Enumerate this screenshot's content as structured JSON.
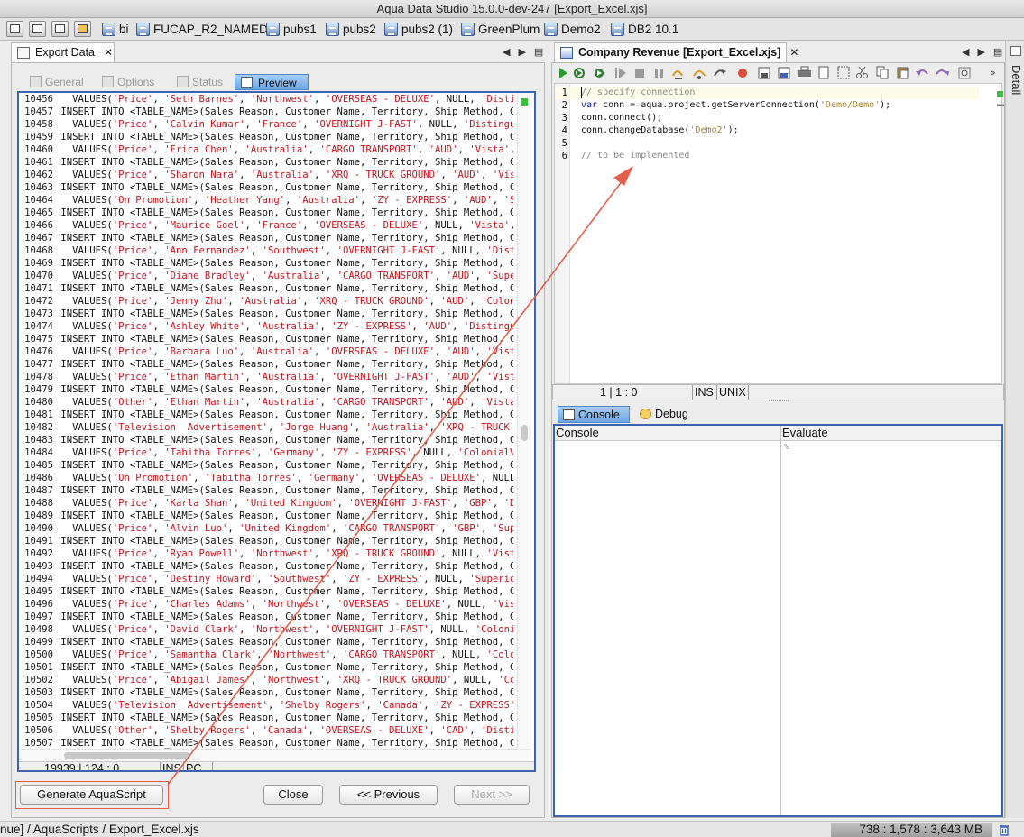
{
  "window": {
    "title": "Aqua Data Studio 15.0.0-dev-247 [Export_Excel.xjs]"
  },
  "connections": [
    {
      "name": "bi"
    },
    {
      "name": "FUCAP_R2_NAMED"
    },
    {
      "name": "pubs1"
    },
    {
      "name": "pubs2"
    },
    {
      "name": "pubs2 (1)"
    },
    {
      "name": "GreenPlum"
    },
    {
      "name": "Demo2"
    },
    {
      "name": "DB2 10.1"
    }
  ],
  "export_panel": {
    "tab_label": "Export Data",
    "close_glyph": "✕",
    "subtabs": {
      "general": "General",
      "options": "Options",
      "status": "Status",
      "preview": "Preview"
    },
    "sql_lines": [
      {
        "n": "10456",
        "k": "v",
        "vals": [
          "'Price'",
          "'Seth Barnes'",
          "'Northwest'",
          "'OVERSEAS - DELUXE'",
          "NULL",
          "'Distingui"
        ]
      },
      {
        "n": "10457",
        "k": "i"
      },
      {
        "n": "10458",
        "k": "v",
        "vals": [
          "'Price'",
          "'Calvin Kumar'",
          "'France'",
          "'OVERNIGHT J-FAST'",
          "NULL",
          "'Distinguish"
        ]
      },
      {
        "n": "10459",
        "k": "i"
      },
      {
        "n": "10460",
        "k": "v",
        "vals": [
          "'Price'",
          "'Erica Chen'",
          "'Australia'",
          "'CARGO TRANSPORT'",
          "'AUD'",
          "'Vista'",
          "'Sc"
        ]
      },
      {
        "n": "10461",
        "k": "i"
      },
      {
        "n": "10462",
        "k": "v",
        "vals": [
          "'Price'",
          "'Sharon Nara'",
          "'Australia'",
          "'XRQ - TRUCK GROUND'",
          "'AUD'",
          "'Vista'"
        ]
      },
      {
        "n": "10463",
        "k": "i"
      },
      {
        "n": "10464",
        "k": "v",
        "vals": [
          "'On Promotion'",
          "'Heather Yang'",
          "'Australia'",
          "'ZY - EXPRESS'",
          "'AUD'",
          "'Super"
        ]
      },
      {
        "n": "10465",
        "k": "i"
      },
      {
        "n": "10466",
        "k": "v",
        "vals": [
          "'Price'",
          "'Maurice Goel'",
          "'France'",
          "'OVERSEAS - DELUXE'",
          "NULL",
          "'Vista'",
          "'Po"
        ]
      },
      {
        "n": "10467",
        "k": "i"
      },
      {
        "n": "10468",
        "k": "v",
        "vals": [
          "'Price'",
          "'Ann Fernandez'",
          "'Southwest'",
          "'OVERNIGHT J-FAST'",
          "NULL",
          "'Distingu"
        ]
      },
      {
        "n": "10469",
        "k": "i"
      },
      {
        "n": "10470",
        "k": "v",
        "vals": [
          "'Price'",
          "'Diane Bradley'",
          "'Australia'",
          "'CARGO TRANSPORT'",
          "'AUD'",
          "'Superior"
        ]
      },
      {
        "n": "10471",
        "k": "i"
      },
      {
        "n": "10472",
        "k": "v",
        "vals": [
          "'Price'",
          "'Jenny Zhu'",
          "'Australia'",
          "'XRQ - TRUCK GROUND'",
          "'AUD'",
          "'ColonialV"
        ]
      },
      {
        "n": "10473",
        "k": "i"
      },
      {
        "n": "10474",
        "k": "v",
        "vals": [
          "'Price'",
          "'Ashley White'",
          "'Australia'",
          "'ZY - EXPRESS'",
          "'AUD'",
          "'Distinguish"
        ]
      },
      {
        "n": "10475",
        "k": "i"
      },
      {
        "n": "10476",
        "k": "v",
        "vals": [
          "'Price'",
          "'Barbara Luo'",
          "'Australia'",
          "'OVERSEAS - DELUXE'",
          "'AUD'",
          "'Vista'"
        ]
      },
      {
        "n": "10477",
        "k": "i"
      },
      {
        "n": "10478",
        "k": "v",
        "vals": [
          "'Price'",
          "'Ethan Martin'",
          "'Australia'",
          "'OVERNIGHT J-FAST'",
          "'AUD'",
          "'Vista'"
        ]
      },
      {
        "n": "10479",
        "k": "i"
      },
      {
        "n": "10480",
        "k": "v",
        "vals": [
          "'Other'",
          "'Ethan Martin'",
          "'Australia'",
          "'CARGO TRANSPORT'",
          "'AUD'",
          "'Vista'",
          "'"
        ]
      },
      {
        "n": "10481",
        "k": "i"
      },
      {
        "n": "10482",
        "k": "v",
        "vals": [
          "'Television  Advertisement'",
          "'Jorge Huang'",
          "'Australia'",
          "'XRQ - TRUCK GROU"
        ]
      },
      {
        "n": "10483",
        "k": "i"
      },
      {
        "n": "10484",
        "k": "v",
        "vals": [
          "'Price'",
          "'Tabitha Torres'",
          "'Germany'",
          "'ZY - EXPRESS'",
          "NULL",
          "'ColonialVoice"
        ]
      },
      {
        "n": "10485",
        "k": "i"
      },
      {
        "n": "10486",
        "k": "v",
        "vals": [
          "'On Promotion'",
          "'Tabitha Torres'",
          "'Germany'",
          "'OVERSEAS - DELUXE'",
          "NULL",
          "'C"
        ]
      },
      {
        "n": "10487",
        "k": "i"
      },
      {
        "n": "10488",
        "k": "v",
        "vals": [
          "'Price'",
          "'Karla Shan'",
          "'United Kingdom'",
          "'OVERNIGHT J-FAST'",
          "'GBP'",
          "'Disti"
        ]
      },
      {
        "n": "10489",
        "k": "i"
      },
      {
        "n": "10490",
        "k": "v",
        "vals": [
          "'Price'",
          "'Alvin Luo'",
          "'United Kingdom'",
          "'CARGO TRANSPORT'",
          "'GBP'",
          "'Superio"
        ]
      },
      {
        "n": "10491",
        "k": "i"
      },
      {
        "n": "10492",
        "k": "v",
        "vals": [
          "'Price'",
          "'Ryan Powell'",
          "'Northwest'",
          "'XRQ - TRUCK GROUND'",
          "NULL",
          "'Vista'"
        ]
      },
      {
        "n": "10493",
        "k": "i"
      },
      {
        "n": "10494",
        "k": "v",
        "vals": [
          "'Price'",
          "'Destiny Howard'",
          "'Southwest'",
          "'ZY - EXPRESS'",
          "NULL",
          "'SuperiorCar"
        ]
      },
      {
        "n": "10495",
        "k": "i"
      },
      {
        "n": "10496",
        "k": "v",
        "vals": [
          "'Price'",
          "'Charles Adams'",
          "'Northwest'",
          "'OVERSEAS - DELUXE'",
          "NULL",
          "'Vista'"
        ]
      },
      {
        "n": "10497",
        "k": "i"
      },
      {
        "n": "10498",
        "k": "v",
        "vals": [
          "'Price'",
          "'David Clark'",
          "'Northwest'",
          "'OVERNIGHT J-FAST'",
          "NULL",
          "'ColonialVo"
        ]
      },
      {
        "n": "10499",
        "k": "i"
      },
      {
        "n": "10500",
        "k": "v",
        "vals": [
          "'Price'",
          "'Samantha Clark'",
          "'Northwest'",
          "'CARGO TRANSPORT'",
          "NULL",
          "'Colonial"
        ]
      },
      {
        "n": "10501",
        "k": "i"
      },
      {
        "n": "10502",
        "k": "v",
        "vals": [
          "'Price'",
          "'Abigail James'",
          "'Northwest'",
          "'XRQ - TRUCK GROUND'",
          "NULL",
          "'Coloni"
        ]
      },
      {
        "n": "10503",
        "k": "i"
      },
      {
        "n": "10504",
        "k": "v",
        "vals": [
          "'Television  Advertisement'",
          "'Shelby Rogers'",
          "'Canada'",
          "'ZY - EXPRESS'",
          "'C"
        ]
      },
      {
        "n": "10505",
        "k": "i"
      },
      {
        "n": "10506",
        "k": "v",
        "vals": [
          "'Other'",
          "'Shelby Rogers'",
          "'Canada'",
          "'OVERSEAS - DELUXE'",
          "'CAD'",
          "'Distingui"
        ]
      },
      {
        "n": "10507",
        "k": "i"
      }
    ],
    "insert_text": "INSERT INTO <TABLE_NAME>(Sales Reason, Customer Name, Territory, Ship Method, Curre",
    "values_prefix": "VALUES(",
    "status": {
      "position": "19939 | 124 : 0",
      "mode": "INS",
      "eol": "PC"
    },
    "buttons": {
      "generate": "Generate AquaScript",
      "close": "Close",
      "previous": "<< Previous",
      "next": "Next >>"
    }
  },
  "editor_panel": {
    "tab_label": "Company Revenue [Export_Excel.xjs]",
    "close_glyph": "✕",
    "code_lines": [
      {
        "n": "1",
        "text": "// specify connection",
        "style": "comment"
      },
      {
        "n": "2",
        "text": "var conn = aqua.project.getServerConnection('Demo/Demo');",
        "style": "code"
      },
      {
        "n": "3",
        "text": "conn.connect();",
        "style": "code"
      },
      {
        "n": "4",
        "text": "conn.changeDatabase('Demo2');",
        "style": "code"
      },
      {
        "n": "5",
        "text": "",
        "style": "code"
      },
      {
        "n": "6",
        "text": "// to be implemented",
        "style": "comment"
      }
    ],
    "status": {
      "position": "1 | 1 : 0",
      "mode": "INS",
      "eol": "UNIX"
    },
    "console_tabs": {
      "console": "Console",
      "debug": "Debug"
    },
    "panes": {
      "console": "Console",
      "evaluate": "Evaluate",
      "evaluate_prompt": "%"
    }
  },
  "detail_strip": {
    "label": "Detail"
  },
  "bottom_bar": {
    "path": "nue] / AquaScripts / Export_Excel.xjs",
    "memory": "738 : 1,578 : 3,643 MB"
  },
  "colors": {
    "accent_blue": "#3d62b1",
    "sql_string": "#c7151e",
    "annotation": "#e4604c",
    "highlight_tab": "#7fb0e8"
  }
}
